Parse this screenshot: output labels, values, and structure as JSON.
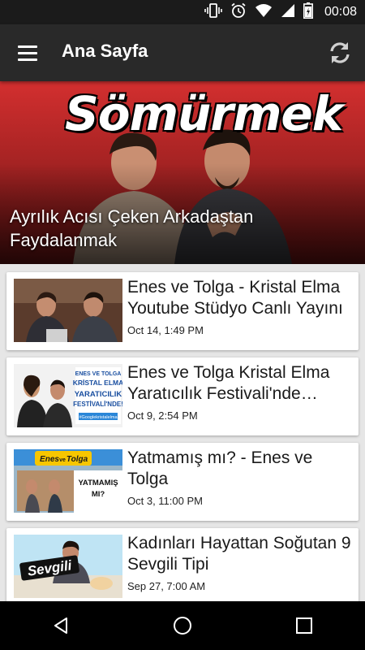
{
  "status_bar": {
    "time": "00:08",
    "icons": [
      "vibrate-icon",
      "alarm-icon",
      "wifi-icon",
      "signal-icon",
      "battery-icon"
    ]
  },
  "app_bar": {
    "title": "Ana Sayfa",
    "menu_icon": "hamburger-menu-icon",
    "refresh_icon": "refresh-icon"
  },
  "featured": {
    "banner_text": "Sömürmek",
    "title": "Ayrılık Acısı Çeken Arkadaştan Faydalanmak"
  },
  "videos": [
    {
      "title": "Enes ve Tolga - Kristal Elma Youtube Stüdyo Canlı Yayını",
      "date": "Oct 14, 1:49 PM"
    },
    {
      "title": "Enes ve Tolga Kristal Elma Yaratıcılık Festivali'nde #Google",
      "date": "Oct 9, 2:54 PM",
      "thumb_text": [
        "ENES VE TOLGA",
        "KRİSTAL ELMA",
        "YARATICILIK",
        "FESTİVALİ'NDE!",
        "#Googlekristalelma"
      ]
    },
    {
      "title": "Yatmamış mı? - Enes ve Tolga",
      "date": "Oct 3, 11:00 PM",
      "thumb_text": [
        "Enes",
        "ve",
        "Tolga",
        "YATMAMIŞ",
        "MI?"
      ]
    },
    {
      "title": "Kadınları Hayattan Soğutan 9 Sevgili Tipi",
      "date": "Sep 27, 7:00 AM",
      "thumb_text": [
        "Sevgili"
      ]
    }
  ],
  "nav_bar": {
    "icons": [
      "back-icon",
      "home-icon",
      "recents-icon"
    ]
  },
  "colors": {
    "app_bar": "#292929",
    "status_bar": "#1b1b1b",
    "background": "#e6e6e6",
    "hero_red": "#c62828"
  }
}
